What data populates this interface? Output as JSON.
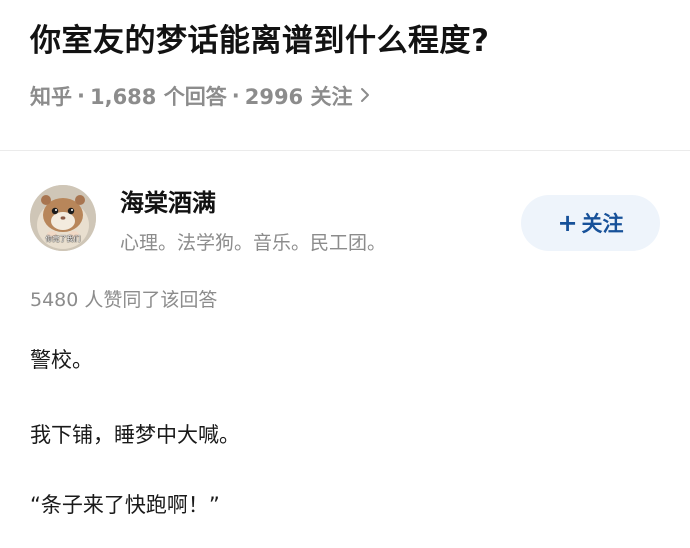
{
  "question": {
    "title": "你室友的梦话能离谱到什么程度?",
    "source": "知乎",
    "answers_count": "1,688 个回答",
    "followers_count": "2996 关注",
    "separator": "·",
    "chevron_icon": "chevron-right-icon"
  },
  "answer": {
    "author": {
      "name": "海棠酒满",
      "bio": "心理。法学狗。音乐。民工团。",
      "avatar_caption": "你完了我们",
      "avatar_icon": "hamster-avatar"
    },
    "follow_button": {
      "plus": "+",
      "label": "关注",
      "color": "#175199",
      "background": "#eef4fb"
    },
    "upvote_text": "5480 人赞同了该回答",
    "paragraphs": [
      "警校。",
      "我下铺，睡梦中大喊。",
      "“条子来了快跑啊！”"
    ]
  }
}
